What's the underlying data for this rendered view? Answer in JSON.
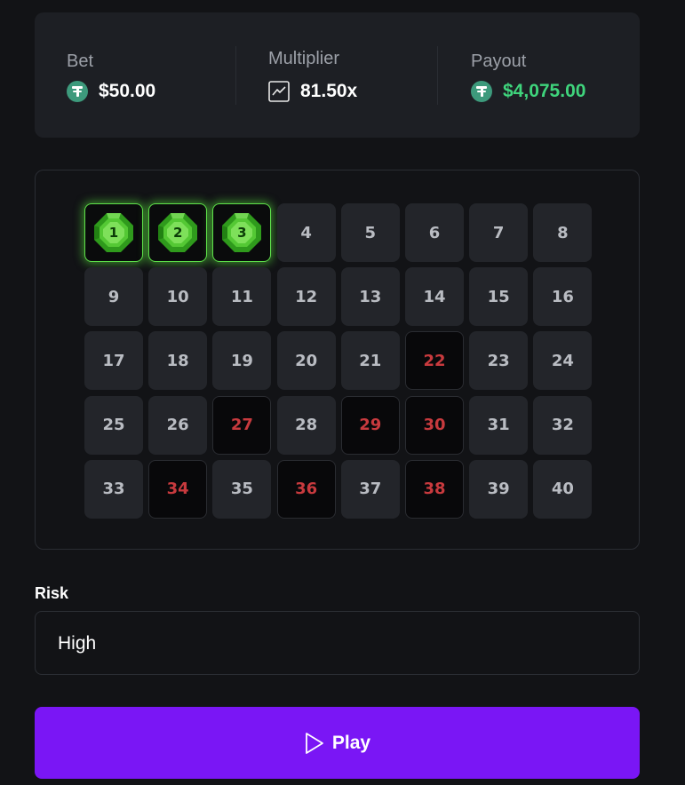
{
  "stats": {
    "bet": {
      "label": "Bet",
      "value": "$50.00",
      "icon": "tether-coin-icon"
    },
    "multiplier": {
      "label": "Multiplier",
      "value": "81.50x",
      "icon": "chart-icon"
    },
    "payout": {
      "label": "Payout",
      "value": "$4,075.00",
      "icon": "tether-coin-icon"
    }
  },
  "board": {
    "columns": 8,
    "tiles": [
      {
        "n": "1",
        "state": "hit"
      },
      {
        "n": "2",
        "state": "hit"
      },
      {
        "n": "3",
        "state": "hit"
      },
      {
        "n": "4",
        "state": "idle"
      },
      {
        "n": "5",
        "state": "idle"
      },
      {
        "n": "6",
        "state": "idle"
      },
      {
        "n": "7",
        "state": "idle"
      },
      {
        "n": "8",
        "state": "idle"
      },
      {
        "n": "9",
        "state": "idle"
      },
      {
        "n": "10",
        "state": "idle"
      },
      {
        "n": "11",
        "state": "idle"
      },
      {
        "n": "12",
        "state": "idle"
      },
      {
        "n": "13",
        "state": "idle"
      },
      {
        "n": "14",
        "state": "idle"
      },
      {
        "n": "15",
        "state": "idle"
      },
      {
        "n": "16",
        "state": "idle"
      },
      {
        "n": "17",
        "state": "idle"
      },
      {
        "n": "18",
        "state": "idle"
      },
      {
        "n": "19",
        "state": "idle"
      },
      {
        "n": "20",
        "state": "idle"
      },
      {
        "n": "21",
        "state": "idle"
      },
      {
        "n": "22",
        "state": "miss"
      },
      {
        "n": "23",
        "state": "idle"
      },
      {
        "n": "24",
        "state": "idle"
      },
      {
        "n": "25",
        "state": "idle"
      },
      {
        "n": "26",
        "state": "idle"
      },
      {
        "n": "27",
        "state": "miss"
      },
      {
        "n": "28",
        "state": "idle"
      },
      {
        "n": "29",
        "state": "miss"
      },
      {
        "n": "30",
        "state": "miss"
      },
      {
        "n": "31",
        "state": "idle"
      },
      {
        "n": "32",
        "state": "idle"
      },
      {
        "n": "33",
        "state": "idle"
      },
      {
        "n": "34",
        "state": "miss"
      },
      {
        "n": "35",
        "state": "idle"
      },
      {
        "n": "36",
        "state": "miss"
      },
      {
        "n": "37",
        "state": "idle"
      },
      {
        "n": "38",
        "state": "miss"
      },
      {
        "n": "39",
        "state": "idle"
      },
      {
        "n": "40",
        "state": "idle"
      }
    ]
  },
  "risk": {
    "label": "Risk",
    "value": "High"
  },
  "play": {
    "label": "Play",
    "icon": "play-icon"
  },
  "colors": {
    "accent": "#7a16f5",
    "payout_green": "#3fd47c",
    "miss_red": "#c83a3e",
    "gem_green": "#5ee04a"
  }
}
